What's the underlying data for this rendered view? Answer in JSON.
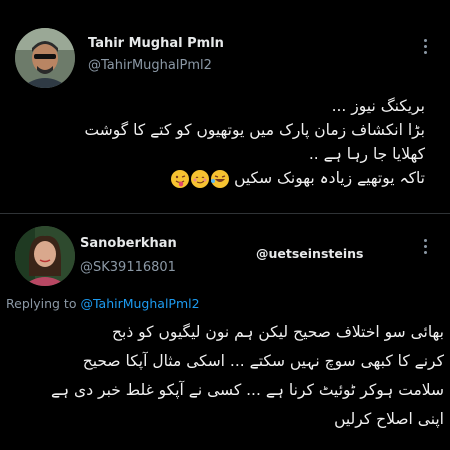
{
  "tweet1": {
    "display_name": "Tahir Mughal Pmln",
    "handle": "@TahirMughalPml2",
    "lines": [
      "بریکنگ نیوز ...",
      "بڑا انکشاف زمان پارک میں یوتھیوں کو کتے کا گوشت",
      "کھلایا جا رہا ہے ..",
      "تاکہ یوتھیے زیادہ بھونک سکیں"
    ],
    "emojis": [
      "rofl-emoji",
      "smirk-emoji",
      "tongue-wink-emoji"
    ]
  },
  "tweet2": {
    "display_name": "Sanoberkhan",
    "handle": "@SK39116801",
    "watermark": "@uetseinsteins",
    "replying_prefix": "Replying to",
    "replying_to": "@TahirMughalPml2",
    "lines": [
      "بھائی سو اختلاف صحیح لیکن ہم نون لیگیوں کو ذبح",
      "کرنے کا کبھی سوچ نہیں سکتے ... اسکی مثال آپکا صحیح",
      "سلامت ہوکر ٹوئیٹ کرنا ہے ... کسی نے آپکو غلط خبر دی ہے",
      "اپنی اصلاح کرلیں"
    ]
  },
  "colors": {
    "background": "#000000",
    "link": "#1d9bf0",
    "muted": "#8b98a5"
  }
}
